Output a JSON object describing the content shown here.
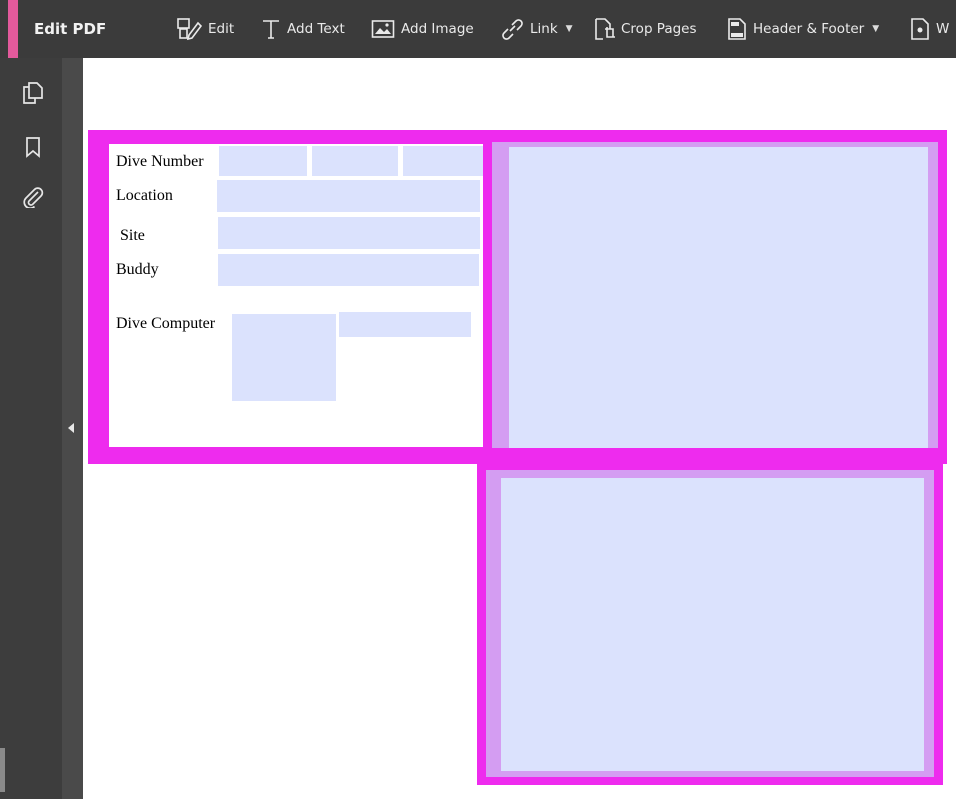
{
  "toolbar": {
    "title": "Edit PDF",
    "items": [
      {
        "label": "Edit",
        "icon": "edit-icon"
      },
      {
        "label": "Add Text",
        "icon": "add-text-icon"
      },
      {
        "label": "Add Image",
        "icon": "add-image-icon"
      },
      {
        "label": "Link",
        "icon": "link-icon",
        "dropdown": true
      },
      {
        "label": "Crop Pages",
        "icon": "crop-pages-icon"
      },
      {
        "label": "Header & Footer",
        "icon": "header-footer-icon",
        "dropdown": true
      },
      {
        "label": "W",
        "icon": "watermark-icon"
      }
    ]
  },
  "sidebar": {
    "icons": [
      "page-thumbnails-icon",
      "bookmark-icon",
      "attachment-icon"
    ]
  },
  "form": {
    "labels": {
      "dive_number": "Dive Number",
      "location": "Location",
      "site": "Site",
      "buddy": "Buddy",
      "dive_computer": "Dive Computer"
    }
  },
  "colors": {
    "toolbar_bg": "#3b3b3b",
    "accent": "#e35a9c",
    "frame_magenta": "#ee2bee",
    "field_fill": "#dbe2fd",
    "frame_light": "#d49df2"
  }
}
